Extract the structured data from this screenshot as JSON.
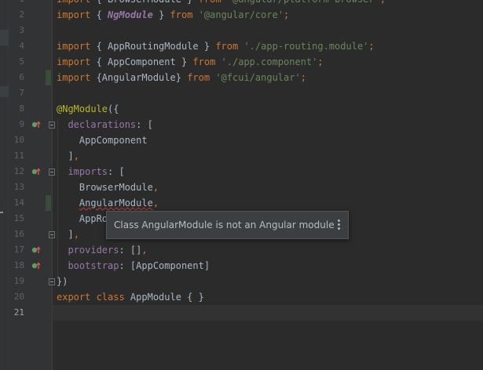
{
  "editor": {
    "lines": [
      {
        "n": "1",
        "tokens": [
          [
            "kw",
            "import"
          ],
          [
            "txt",
            " { BrowserModule } "
          ],
          [
            "kw",
            "from"
          ],
          [
            "txt",
            " "
          ],
          [
            "str",
            "'@angular/platform-browser'"
          ],
          [
            "kw",
            ";"
          ]
        ]
      },
      {
        "n": "2",
        "tokens": [
          [
            "kw",
            "import"
          ],
          [
            "txt",
            " { "
          ],
          [
            "dec",
            "NgModule"
          ],
          [
            "txt",
            " } "
          ],
          [
            "kw",
            "from"
          ],
          [
            "txt",
            " "
          ],
          [
            "str",
            "'@angular/core'"
          ],
          [
            "kw",
            ";"
          ]
        ]
      },
      {
        "n": "3",
        "tokens": []
      },
      {
        "n": "4",
        "tokens": [
          [
            "kw",
            "import"
          ],
          [
            "txt",
            " { AppRoutingModule } "
          ],
          [
            "kw",
            "from"
          ],
          [
            "txt",
            " "
          ],
          [
            "str",
            "'./app-routing.module'"
          ],
          [
            "kw",
            ";"
          ]
        ]
      },
      {
        "n": "5",
        "tokens": [
          [
            "kw",
            "import"
          ],
          [
            "txt",
            " { AppComponent } "
          ],
          [
            "kw",
            "from"
          ],
          [
            "txt",
            " "
          ],
          [
            "str",
            "'./app.component'"
          ],
          [
            "kw",
            ";"
          ]
        ]
      },
      {
        "n": "6",
        "tokens": [
          [
            "kw",
            "import"
          ],
          [
            "txt",
            " {AngularModule} "
          ],
          [
            "kw",
            "from"
          ],
          [
            "txt",
            " "
          ],
          [
            "str",
            "'@fcui/angular'"
          ],
          [
            "kw",
            ";"
          ]
        ]
      },
      {
        "n": "7",
        "tokens": []
      },
      {
        "n": "8",
        "tokens": [
          [
            "anno",
            "@NgModule"
          ],
          [
            "txt",
            "({"
          ]
        ]
      },
      {
        "n": "9",
        "tokens": [
          [
            "txt",
            "  "
          ],
          [
            "prop",
            "declarations"
          ],
          [
            "txt",
            ": ["
          ]
        ]
      },
      {
        "n": "10",
        "tokens": [
          [
            "txt",
            "    AppComponent"
          ]
        ]
      },
      {
        "n": "11",
        "tokens": [
          [
            "txt",
            "  ]"
          ],
          [
            "kw",
            ","
          ]
        ]
      },
      {
        "n": "12",
        "tokens": [
          [
            "txt",
            "  "
          ],
          [
            "prop",
            "imports"
          ],
          [
            "txt",
            ": ["
          ]
        ]
      },
      {
        "n": "13",
        "tokens": [
          [
            "txt",
            "    BrowserModule"
          ],
          [
            "kw",
            ","
          ]
        ]
      },
      {
        "n": "14",
        "tokens": [
          [
            "txt",
            "    "
          ],
          [
            "err",
            "AngularModule"
          ],
          [
            "kw",
            ","
          ]
        ]
      },
      {
        "n": "15",
        "tokens": [
          [
            "txt",
            "    AppRo"
          ]
        ]
      },
      {
        "n": "16",
        "tokens": [
          [
            "txt",
            "  ]"
          ],
          [
            "kw",
            ","
          ]
        ]
      },
      {
        "n": "17",
        "tokens": [
          [
            "txt",
            "  "
          ],
          [
            "prop",
            "providers"
          ],
          [
            "txt",
            ": []"
          ],
          [
            "kw",
            ","
          ]
        ]
      },
      {
        "n": "18",
        "tokens": [
          [
            "txt",
            "  "
          ],
          [
            "prop",
            "bootstrap"
          ],
          [
            "txt",
            ": [AppComponent]"
          ]
        ]
      },
      {
        "n": "19",
        "tokens": [
          [
            "txt",
            "})"
          ]
        ]
      },
      {
        "n": "20",
        "tokens": [
          [
            "kw",
            "export class"
          ],
          [
            "txt",
            " AppModule { }"
          ]
        ]
      },
      {
        "n": "21",
        "tokens": []
      }
    ],
    "current_line": "21"
  },
  "tooltip": {
    "message": "Class AngularModule is not an Angular module",
    "menu_icon": "kebab-menu-icon"
  },
  "colors": {
    "background": "#2b2b2b",
    "gutter": "#313335",
    "keyword": "#cc7832",
    "string": "#6a8759",
    "annotation": "#bbb529",
    "property": "#9876aa",
    "error_underline": "#bc3f3c"
  }
}
